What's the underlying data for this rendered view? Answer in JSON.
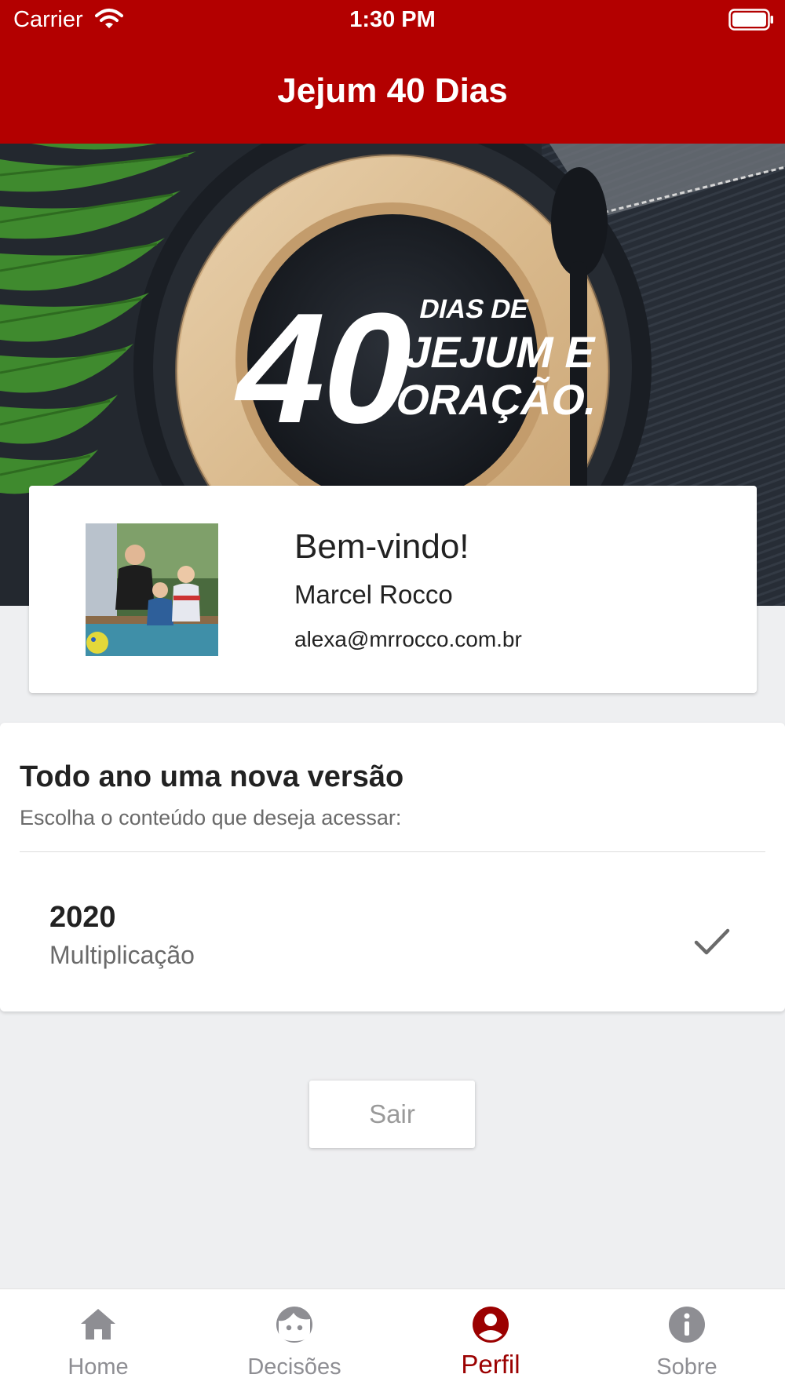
{
  "status_bar": {
    "carrier": "Carrier",
    "time": "1:30 PM"
  },
  "nav": {
    "title": "Jejum 40 Dias"
  },
  "hero": {
    "number": "40",
    "line1": "DIAS DE",
    "line2": "JEJUM E",
    "line3": "ORAÇÃO."
  },
  "profile": {
    "welcome": "Bem-vindo!",
    "name": "Marcel Rocco",
    "email": "alexa@mrrocco.com.br"
  },
  "versions": {
    "title": "Todo ano uma nova versão",
    "subtitle": "Escolha o conteúdo que deseja acessar:",
    "items": [
      {
        "year": "2020",
        "name": "Multiplicação",
        "selected": true
      }
    ]
  },
  "logout": {
    "label": "Sair"
  },
  "tabs": [
    {
      "label": "Home",
      "icon": "home-icon",
      "active": false
    },
    {
      "label": "Decisões",
      "icon": "face-icon",
      "active": false
    },
    {
      "label": "Perfil",
      "icon": "person-icon",
      "active": true
    },
    {
      "label": "Sobre",
      "icon": "info-icon",
      "active": false
    }
  ],
  "colors": {
    "brand": "#b30000",
    "tab_active": "#9b0000",
    "tab_inactive": "#8e8e93"
  }
}
